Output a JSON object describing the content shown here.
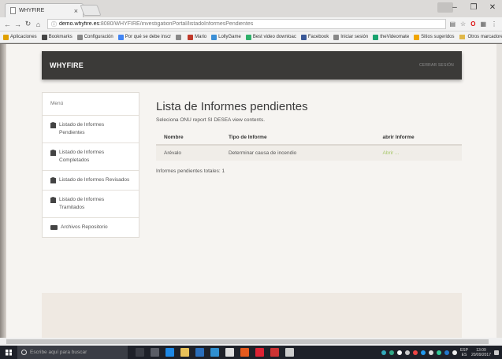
{
  "browser": {
    "tab_title": "WHYFIRE",
    "url_host": "demo.whyfire.es",
    "url_path": ":8080/WHYFIRE/investigationPortal/listadoInformesPendientes",
    "bookmarks": [
      {
        "label": "Aplicaciones",
        "color": "#e0a000"
      },
      {
        "label": "Bookmarks",
        "color": "#444444"
      },
      {
        "label": "Configuración",
        "color": "#888888"
      },
      {
        "label": "Por qué se debe inscr",
        "color": "#4285f4"
      },
      {
        "label": "",
        "color": "#888888"
      },
      {
        "label": "Mario",
        "color": "#c0392b"
      },
      {
        "label": "LollyGame",
        "color": "#3b8fd6"
      },
      {
        "label": "Best video downloac",
        "color": "#2fb06b"
      },
      {
        "label": "Facebook",
        "color": "#3b5998"
      },
      {
        "label": "Iniciar sesión",
        "color": "#888888"
      },
      {
        "label": "theVideomate",
        "color": "#1aa36f"
      },
      {
        "label": "Sitios sugeridos",
        "color": "#f0a500"
      }
    ],
    "other_bookmarks": "Otros marcadores"
  },
  "app": {
    "brand": "WHYFIRE",
    "logout": "CERRAR SESIÓN"
  },
  "sidebar": {
    "menu_label": "Menú",
    "items": [
      {
        "label": "Listado de Informes Pendientes",
        "icon": "document-icon"
      },
      {
        "label": "Listado de Informes Completados",
        "icon": "document-icon"
      },
      {
        "label": "Listado de Informes Revisados",
        "icon": "document-icon"
      },
      {
        "label": "Listado de Informes Tramitados",
        "icon": "document-icon"
      },
      {
        "label": "Archivos Repositorio",
        "icon": "folder-icon"
      }
    ]
  },
  "main": {
    "title": "Lista de Informes pendientes",
    "subtitle": "Seleciona ONU report SI DESEA view contents.",
    "table": {
      "headers": [
        "Nombre",
        "Tipo de Informe",
        "abrir Informe"
      ],
      "rows": [
        {
          "nombre": "Arévalo",
          "tipo": "Determinar causa de incendio",
          "abrir": "Abrir ..."
        }
      ]
    },
    "totals": "Informes pendientes totales: 1"
  },
  "taskbar": {
    "search_placeholder": "Escribe aquí para buscar",
    "lang": "ESP",
    "lang_sub": "ES",
    "time": "13:09",
    "date": "20/09/2017"
  },
  "colors": {
    "header_bg": "#3b3a38",
    "accent_link": "#a7c86a",
    "page_bg": "#f6f4f1"
  }
}
